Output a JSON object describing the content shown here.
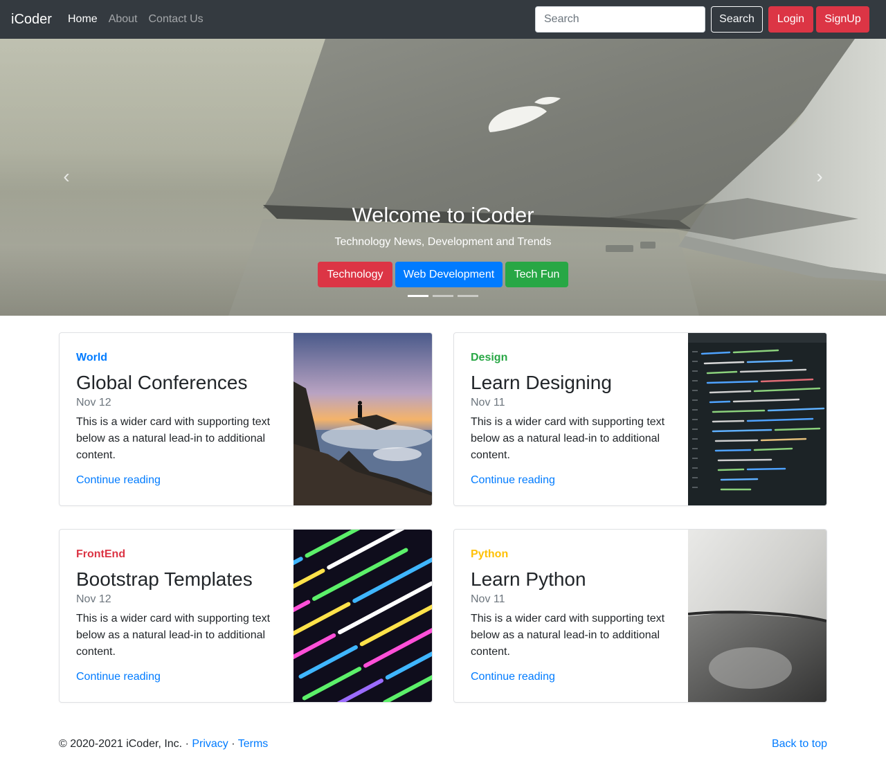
{
  "navbar": {
    "brand": "iCoder",
    "links": [
      {
        "label": "Home",
        "active": true
      },
      {
        "label": "About",
        "active": false
      },
      {
        "label": "Contact Us",
        "active": false
      }
    ],
    "search_placeholder": "Search",
    "search_button": "Search",
    "login_button": "Login",
    "signup_button": "SignUp"
  },
  "carousel": {
    "title": "Welcome to iCoder",
    "subtitle": "Technology News, Development and Trends",
    "buttons": [
      "Technology",
      "Web Development",
      "Tech Fun"
    ],
    "active_slide": 1,
    "slide_count": 3
  },
  "cards": [
    {
      "category": "World",
      "category_color": "#007bff",
      "title": "Global Conferences",
      "date": "Nov 12",
      "text": "This is a wider card with supporting text below as a natural lead-in to additional content.",
      "link": "Continue reading",
      "image": "sunset-coast"
    },
    {
      "category": "Design",
      "category_color": "#28a745",
      "title": "Learn Designing",
      "date": "Nov 11",
      "text": "This is a wider card with supporting text below as a natural lead-in to additional content.",
      "link": "Continue reading",
      "image": "code-editor-dark"
    },
    {
      "category": "FrontEnd",
      "category_color": "#dc3545",
      "title": "Bootstrap Templates",
      "date": "Nov 12",
      "text": "This is a wider card with supporting text below as a natural lead-in to additional content.",
      "link": "Continue reading",
      "image": "colorful-code"
    },
    {
      "category": "Python",
      "category_color": "#ffc107",
      "title": "Learn Python",
      "date": "Nov 11",
      "text": "This is a wider card with supporting text below as a natural lead-in to additional content.",
      "link": "Continue reading",
      "image": "phone-closeup"
    }
  ],
  "footer": {
    "copyright": "© 2020-2021 iCoder, Inc. · ",
    "privacy": "Privacy",
    "separator": " · ",
    "terms": "Terms",
    "back_to_top": "Back to top"
  }
}
